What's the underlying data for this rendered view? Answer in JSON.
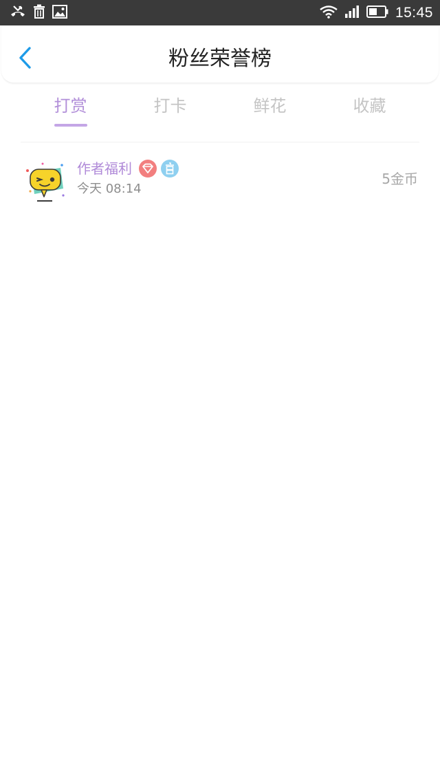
{
  "status_bar": {
    "time": "15:45",
    "left_icons": [
      "missed-call-icon",
      "trash-icon",
      "image-icon"
    ],
    "right_icons": [
      "wifi-icon",
      "signal-icon",
      "battery-icon"
    ]
  },
  "header": {
    "title": "粉丝荣誉榜",
    "back_icon": "chevron-left-icon",
    "accent_color": "#1e9be8"
  },
  "tabs": [
    {
      "label": "打赏",
      "active": true
    },
    {
      "label": "打卡",
      "active": false
    },
    {
      "label": "鲜花",
      "active": false
    },
    {
      "label": "收藏",
      "active": false
    }
  ],
  "active_tab_color": "#b28fd9",
  "list": [
    {
      "username": "作者福利",
      "badges": [
        "diamond-badge-icon",
        "official-badge-icon"
      ],
      "time": "今天 08:14",
      "amount": "5金币",
      "avatar_icon": "wink-chat-bubble-avatar"
    }
  ]
}
